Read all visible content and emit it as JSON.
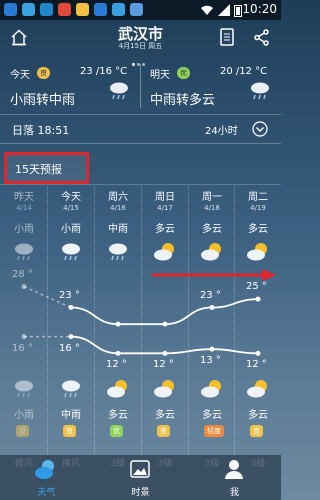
{
  "status_bar": {
    "time": "10:20"
  },
  "header": {
    "city": "武汉市",
    "date": "4月15日 周五"
  },
  "today": {
    "label": "今天",
    "aq": "良",
    "temp": "23 /16 °C",
    "condition": "小雨转中雨"
  },
  "tomorrow": {
    "label": "明天",
    "aq": "优",
    "temp": "20 /12 °C",
    "condition": "中雨转多云"
  },
  "sunset": {
    "text": "日落 18:51",
    "toggle": "24小时"
  },
  "forecast": {
    "label": "15天预报",
    "days": [
      {
        "day": "昨天",
        "date": "4/14",
        "day_cond": "小雨",
        "night_cond": "小雨",
        "high": "28 °",
        "low": "16 °",
        "aq": "良",
        "wind": "微风"
      },
      {
        "day": "今天",
        "date": "4/15",
        "day_cond": "小雨",
        "night_cond": "中雨",
        "high": "23 °",
        "low": "16 °",
        "aq": "良",
        "wind": "微风"
      },
      {
        "day": "周六",
        "date": "4/16",
        "day_cond": "中雨",
        "night_cond": "多云",
        "high": "",
        "low": "12 °",
        "aq": "优",
        "wind": "3级"
      },
      {
        "day": "周日",
        "date": "4/17",
        "day_cond": "多云",
        "night_cond": "多云",
        "high": "",
        "low": "12 °",
        "aq": "良",
        "wind": "3级"
      },
      {
        "day": "周一",
        "date": "4/18",
        "day_cond": "多云",
        "night_cond": "多云",
        "high": "23 °",
        "low": "13 °",
        "aq": "轻度",
        "wind": "3级"
      },
      {
        "day": "周二",
        "date": "4/19",
        "day_cond": "多云",
        "night_cond": "多云",
        "high": "25 °",
        "low": "12 °",
        "aq": "良",
        "wind": "3级"
      }
    ]
  },
  "bottom_nav": {
    "weather": "天气",
    "scenery": "时景",
    "me": "我"
  },
  "colors": {
    "accent": "#e0262a",
    "aq_good": "#f0c24a",
    "aq_excellent": "#8fd35a",
    "aq_light": "#f08a3a"
  }
}
